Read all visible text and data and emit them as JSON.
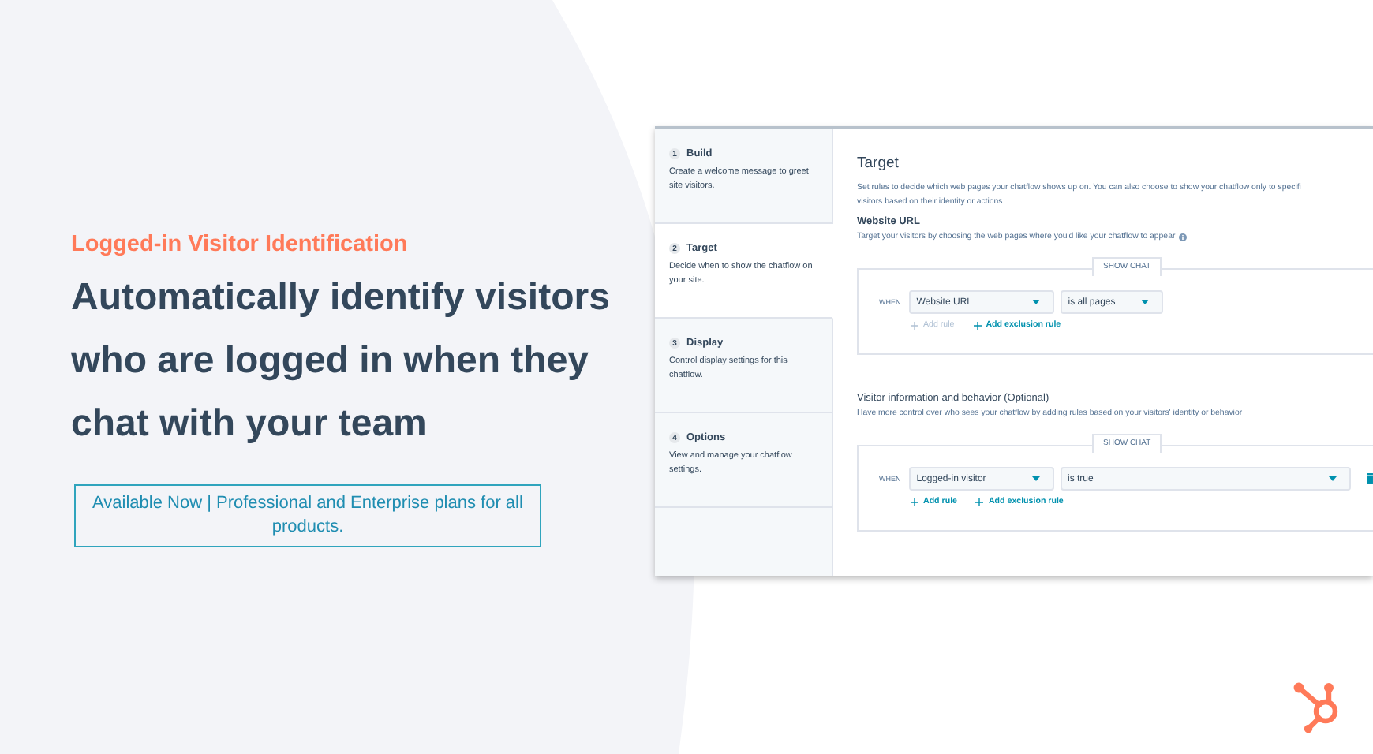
{
  "eyebrow": "Logged-in Visitor Identification",
  "headline": "Automatically identify visitors who are logged in when they chat with your team",
  "availability": "Available Now | Professional and Enterprise plans for all products.",
  "screenshot": {
    "steps": [
      {
        "number": "1",
        "title": "Build",
        "description": "Create a welcome message to greet site visitors.",
        "selected": false
      },
      {
        "number": "2",
        "title": "Target",
        "description": "Decide when to show the chatflow on your site.",
        "selected": true
      },
      {
        "number": "3",
        "title": "Display",
        "description": "Control display settings for this chatflow.",
        "selected": false
      },
      {
        "number": "4",
        "title": "Options",
        "description": "View and manage your chatflow settings.",
        "selected": false
      }
    ],
    "title": "Target",
    "description_lines": [
      "Set rules to decide which web pages your chatflow shows up on. You can also choose to show your chatflow only to specifi",
      "visitors based on their identity or actions."
    ],
    "sections": [
      {
        "heading": "Website URL",
        "description": "Target your visitors by choosing the web pages where you'd like your chatflow to appear",
        "info": true,
        "tab": "SHOW CHAT",
        "when": "WHEN",
        "fields": [
          {
            "value": "Website URL",
            "wide": false
          },
          {
            "value": "is all pages",
            "wide": false
          }
        ],
        "links": [
          {
            "label": "Add rule",
            "disabled": true
          },
          {
            "label": "Add exclusion rule",
            "disabled": false
          }
        ],
        "delete": false
      },
      {
        "heading": "Visitor information and behavior (Optional)",
        "description": "Have more control over who sees your chatflow by adding rules based on your visitors' identity or behavior",
        "info": false,
        "tab": "SHOW CHAT",
        "when": "WHEN",
        "fields": [
          {
            "value": "Logged-in visitor",
            "wide": false
          },
          {
            "value": "is true",
            "wide": true
          }
        ],
        "links": [
          {
            "label": "Add rule",
            "disabled": false
          },
          {
            "label": "Add exclusion rule",
            "disabled": false
          }
        ],
        "delete": true
      }
    ]
  }
}
